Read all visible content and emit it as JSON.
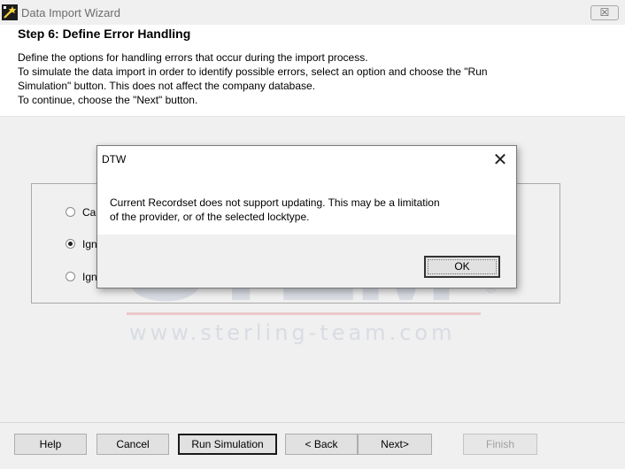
{
  "window": {
    "title": "Data Import Wizard",
    "close_glyph": "☒"
  },
  "header": {
    "step_title": "Step 6: Define Error Handling",
    "description": [
      "Define the options for handling errors that occur during the import process.",
      "To simulate the data import in order to identify possible errors, select an option and choose the \"Run",
      "Simulation\" button. This does not affect the company database.",
      "To continue, choose the \"Next\" button."
    ]
  },
  "options": [
    {
      "label": "Ca",
      "selected": false
    },
    {
      "label": "Ign",
      "selected": true
    },
    {
      "label": "Ign",
      "selected": false
    }
  ],
  "watermark": {
    "logo": "STEM",
    "registered": "®",
    "url": "www.sterling-team.com"
  },
  "buttons": {
    "help": "Help",
    "cancel": "Cancel",
    "run_simulation": "Run Simulation",
    "back": "< Back",
    "next": "Next>",
    "finish": "Finish"
  },
  "dialog": {
    "title": "DTW",
    "close_glyph": "✕",
    "message": [
      "Current Recordset does not support updating. This may be a limitation",
      "of the provider, or of the selected locktype."
    ],
    "ok_label": "OK"
  },
  "colors": {
    "window_bg": "#f0f0f0",
    "button_bg": "#e1e1e1",
    "watermark_text": "#c6ccda",
    "watermark_bar": "#e7a8ad"
  }
}
